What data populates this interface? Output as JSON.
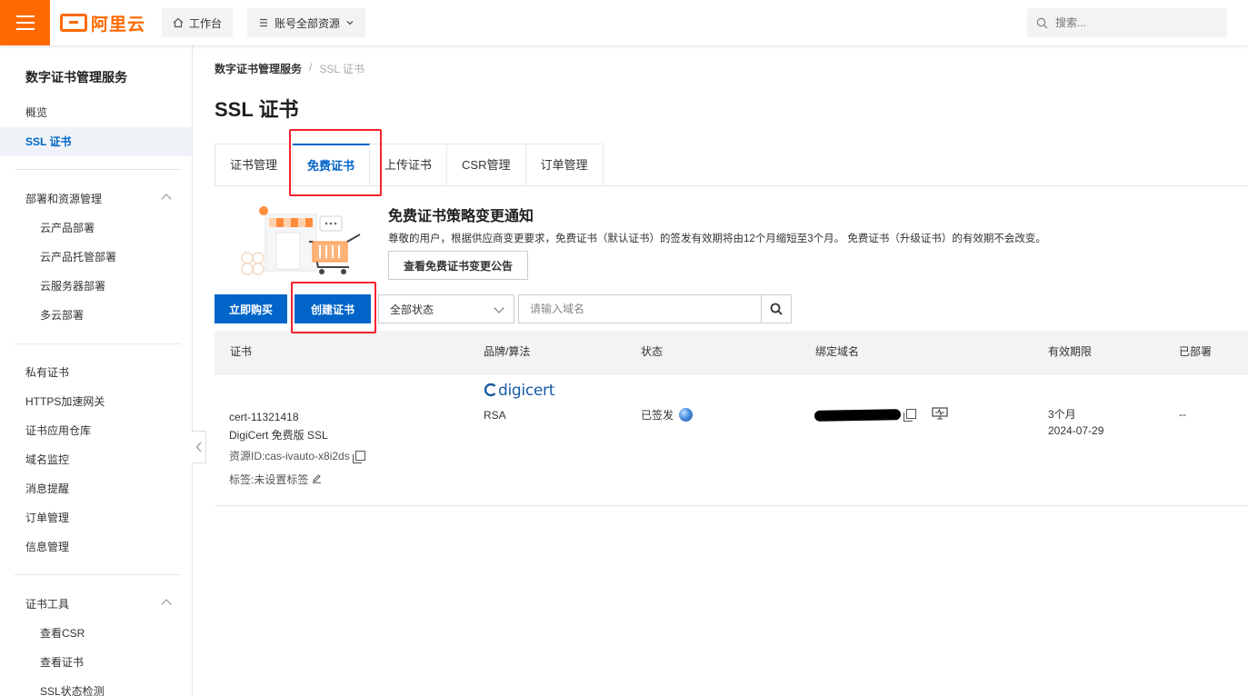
{
  "topbar": {
    "logo_text": "阿里云",
    "workbench_label": "工作台",
    "resources_label": "账号全部资源",
    "search_placeholder": "搜索..."
  },
  "sidebar": {
    "title": "数字证书管理服务",
    "top_items": [
      "概览",
      "SSL 证书"
    ],
    "group1": {
      "label": "部署和资源管理",
      "items": [
        "云产品部署",
        "云产品托管部署",
        "云服务器部署",
        "多云部署"
      ]
    },
    "middle_items": [
      "私有证书",
      "HTTPS加速网关",
      "证书应用仓库",
      "域名监控",
      "消息提醒",
      "订单管理",
      "信息管理"
    ],
    "group2": {
      "label": "证书工具",
      "items": [
        "查看CSR",
        "查看证书",
        "SSL状态检测"
      ]
    }
  },
  "breadcrumb": {
    "first": "数字证书管理服务",
    "sep": "/",
    "last": "SSL 证书"
  },
  "page_title": "SSL 证书",
  "tabs": [
    "证书管理",
    "免费证书",
    "上传证书",
    "CSR管理",
    "订单管理"
  ],
  "notice": {
    "title": "免费证书策略变更通知",
    "text": "尊敬的用户，根据供应商变更要求，免费证书（默认证书）的签发有效期将由12个月缩短至3个月。 免费证书（升级证书）的有效期不会改变。",
    "button": "查看免费证书变更公告"
  },
  "toolbar": {
    "buy_label": "立即购买",
    "create_label": "创建证书",
    "status_select": "全部状态",
    "domain_placeholder": "请输入域名"
  },
  "table": {
    "headers": [
      "证书",
      "品牌/算法",
      "状态",
      "绑定域名",
      "有效期限",
      "已部署"
    ],
    "row": {
      "cert_id": "cert-11321418",
      "cert_name": "DigiCert 免费版 SSL",
      "resource_id": "资源ID:cas-ivauto-x8i2ds",
      "tag": "标签:未设置标签",
      "brand_logo": "digicert",
      "algorithm": "RSA",
      "status": "已签发",
      "validity": "3个月",
      "expiry": "2024-07-29",
      "deployed": "--"
    }
  },
  "colors": {
    "brand_orange": "#ff6a00",
    "primary_blue": "#0064c8",
    "highlight_red": "#f5222d"
  }
}
